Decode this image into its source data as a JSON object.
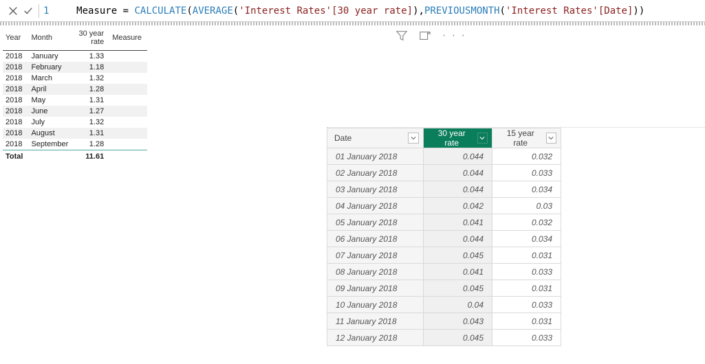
{
  "formula": {
    "line_number": "1",
    "measure_name": "Measure",
    "equals": " = ",
    "fn1": "CALCULATE",
    "open1": "(",
    "fn2": "AVERAGE",
    "open2": "(",
    "ref1": "'Interest Rates'[30 year rate]",
    "close2": ")",
    "comma": ",",
    "fn3": "PREVIOUSMONTH",
    "open3": "(",
    "ref2": "'Interest Rates'[Date]",
    "close3": ")",
    "close1": ")"
  },
  "matrix": {
    "headers": {
      "year": "Year",
      "month": "Month",
      "rate": "30 year rate",
      "measure": "Measure"
    },
    "rows": [
      {
        "year": "2018",
        "month": "January",
        "rate": "1.33",
        "measure": ""
      },
      {
        "year": "2018",
        "month": "February",
        "rate": "1.18",
        "measure": ""
      },
      {
        "year": "2018",
        "month": "March",
        "rate": "1.32",
        "measure": ""
      },
      {
        "year": "2018",
        "month": "April",
        "rate": "1.28",
        "measure": ""
      },
      {
        "year": "2018",
        "month": "May",
        "rate": "1.31",
        "measure": ""
      },
      {
        "year": "2018",
        "month": "June",
        "rate": "1.27",
        "measure": ""
      },
      {
        "year": "2018",
        "month": "July",
        "rate": "1.32",
        "measure": ""
      },
      {
        "year": "2018",
        "month": "August",
        "rate": "1.31",
        "measure": ""
      },
      {
        "year": "2018",
        "month": "September",
        "rate": "1.28",
        "measure": ""
      }
    ],
    "total_label": "Total",
    "total_value": "11.61"
  },
  "grid": {
    "columns": {
      "date": "Date",
      "rate30": "30 year rate",
      "rate15": "15 year rate"
    },
    "rows": [
      {
        "date": "01 January 2018",
        "r30": "0.044",
        "r15": "0.032"
      },
      {
        "date": "02 January 2018",
        "r30": "0.044",
        "r15": "0.033"
      },
      {
        "date": "03 January 2018",
        "r30": "0.044",
        "r15": "0.034"
      },
      {
        "date": "04 January 2018",
        "r30": "0.042",
        "r15": "0.03"
      },
      {
        "date": "05 January 2018",
        "r30": "0.041",
        "r15": "0.032"
      },
      {
        "date": "06 January 2018",
        "r30": "0.044",
        "r15": "0.034"
      },
      {
        "date": "07 January 2018",
        "r30": "0.045",
        "r15": "0.031"
      },
      {
        "date": "08 January 2018",
        "r30": "0.041",
        "r15": "0.033"
      },
      {
        "date": "09 January 2018",
        "r30": "0.045",
        "r15": "0.031"
      },
      {
        "date": "10 January 2018",
        "r30": "0.04",
        "r15": "0.033"
      },
      {
        "date": "11 January 2018",
        "r30": "0.043",
        "r15": "0.031"
      },
      {
        "date": "12 January 2018",
        "r30": "0.045",
        "r15": "0.033"
      }
    ]
  }
}
